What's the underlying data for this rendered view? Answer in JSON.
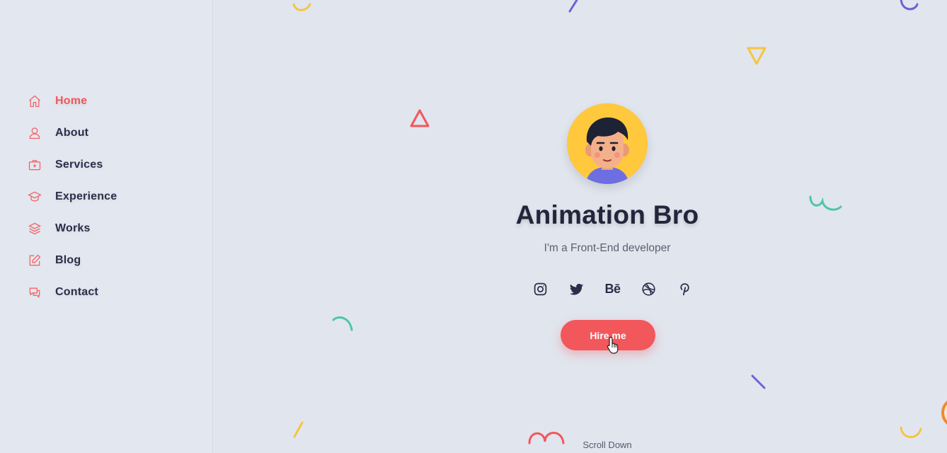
{
  "sidebar": {
    "items": [
      {
        "label": "Home",
        "icon": "home-icon",
        "active": true
      },
      {
        "label": "About",
        "icon": "user-icon",
        "active": false
      },
      {
        "label": "Services",
        "icon": "briefcase-icon",
        "active": false
      },
      {
        "label": "Experience",
        "icon": "graduation-cap-icon",
        "active": false
      },
      {
        "label": "Works",
        "icon": "layers-icon",
        "active": false
      },
      {
        "label": "Blog",
        "icon": "edit-icon",
        "active": false
      },
      {
        "label": "Contact",
        "icon": "chat-icon",
        "active": false
      }
    ]
  },
  "hero": {
    "name": "Animation Bro",
    "tagline": "I'm a Front-End developer",
    "social": [
      {
        "icon": "instagram-icon"
      },
      {
        "icon": "twitter-icon"
      },
      {
        "icon": "behance-icon",
        "text": "Bē"
      },
      {
        "icon": "dribbble-icon"
      },
      {
        "icon": "pinterest-icon"
      }
    ],
    "cta": "Hire me",
    "scroll_label": "Scroll Down"
  },
  "colors": {
    "accent": "#f2575c",
    "text_dark": "#2a2e48",
    "background": "#e1e5ee",
    "avatar_bg": "#ffc83d"
  }
}
